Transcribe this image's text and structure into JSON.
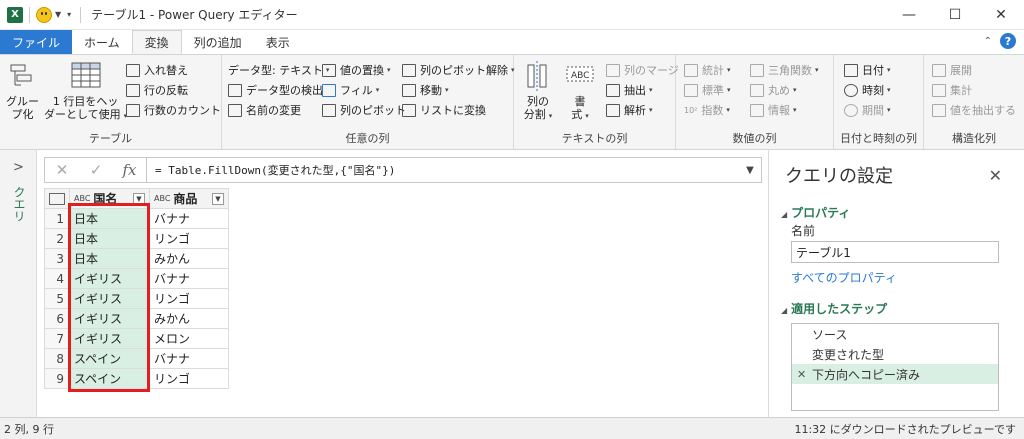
{
  "window": {
    "title": "テーブル1 - Power Query エディター",
    "controls": [
      "—",
      "☐",
      "✕"
    ]
  },
  "tabs": [
    "ファイル",
    "ホーム",
    "変換",
    "列の追加",
    "表示"
  ],
  "ribbon": {
    "group_table": {
      "label": "テーブル",
      "group_by": "グループ化",
      "group_by_line1": "グルー",
      "group_by_line2": "プ化",
      "first_row": "1 行目をヘッ",
      "first_row_line2": "ダーとして使用",
      "transpose": "入れ替え",
      "reverse": "行の反転",
      "count": "行数のカウント"
    },
    "group_any": {
      "label": "任意の列",
      "datatype": "データ型: テキスト",
      "detect": "データ型の検出",
      "rename": "名前の変更",
      "replace": "値の置換",
      "fill": "フィル",
      "pivot": "列のピボット",
      "unpivot": "列のピボット解除",
      "move": "移動",
      "to_list": "リストに変換"
    },
    "group_text": {
      "label": "テキストの列",
      "split_line1": "列の",
      "split_line2": "分割",
      "format_line1": "書",
      "format_line2": "式",
      "merge": "列のマージ",
      "extract": "抽出",
      "parse": "解析",
      "abc": "ABC",
      "abc123": "123"
    },
    "group_number": {
      "label": "数値の列",
      "stats": "統計",
      "standard": "標準",
      "scientific": "指数",
      "trig": "三角関数",
      "rounding": "丸め",
      "info": "情報",
      "ten": "10²"
    },
    "group_datetime": {
      "label": "日付と時刻の列",
      "date": "日付",
      "time": "時刻",
      "duration": "期間"
    },
    "group_struct": {
      "label": "構造化列",
      "expand": "展開",
      "aggregate": "集計",
      "extract_values": "値を抽出する"
    }
  },
  "query_pane": {
    "label": "クエリ",
    "chevron": ">"
  },
  "formula_bar": {
    "cancel": "✕",
    "confirm": "✓",
    "fx": "fx",
    "formula": "= Table.FillDown(変更された型,{\"国名\"})"
  },
  "grid": {
    "columns": [
      {
        "type": "ABC",
        "name": "国名"
      },
      {
        "type": "ABC",
        "name": "商品"
      }
    ],
    "rows": [
      [
        "1",
        "日本",
        "バナナ"
      ],
      [
        "2",
        "日本",
        "リンゴ"
      ],
      [
        "3",
        "日本",
        "みかん"
      ],
      [
        "4",
        "イギリス",
        "バナナ"
      ],
      [
        "5",
        "イギリス",
        "リンゴ"
      ],
      [
        "6",
        "イギリス",
        "みかん"
      ],
      [
        "7",
        "イギリス",
        "メロン"
      ],
      [
        "8",
        "スペイン",
        "バナナ"
      ],
      [
        "9",
        "スペイン",
        "リンゴ"
      ]
    ],
    "highlight_color": "#e02020"
  },
  "settings": {
    "title": "クエリの設定",
    "properties": "プロパティ",
    "name_label": "名前",
    "name_value": "テーブル1",
    "all_properties": "すべてのプロパティ",
    "applied_steps": "適用したステップ",
    "steps": [
      "ソース",
      "変更された型",
      "下方向へコピー済み"
    ]
  },
  "status": {
    "left": "2 列, 9 行",
    "right": "11:32 にダウンロードされたプレビューです"
  },
  "colors": {
    "accent": "#2b79d0",
    "green": "#2b7a56",
    "selection": "#d9efe3"
  }
}
